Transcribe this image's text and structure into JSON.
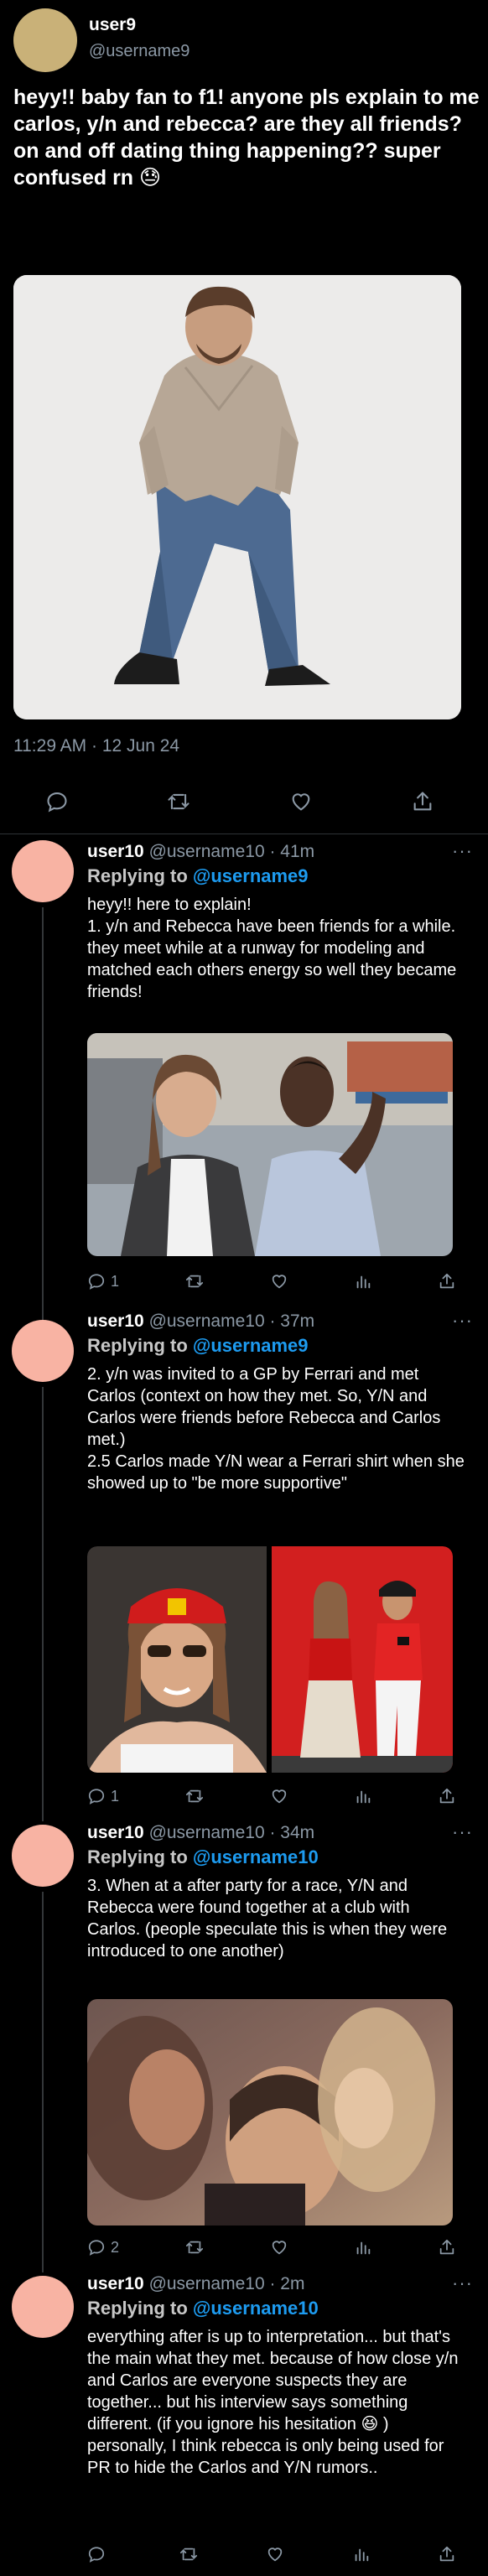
{
  "main_tweet": {
    "display_name": "user9",
    "handle": "@username9",
    "text": "heyy!! baby fan to f1! anyone pls explain to me carlos, y/n and rebecca? are they all friends? on and off dating thing happening?? super confused rn",
    "emoji": "😓",
    "timestamp": "11:29 AM · 12 Jun 24",
    "actions": [
      "reply-icon",
      "retweet-icon",
      "like-icon",
      "share-icon"
    ]
  },
  "replies": [
    {
      "display_name": "user10",
      "meta": "@username10 · 41m",
      "more": "···",
      "replying_prefix": "Replying to ",
      "replying_to": "@username9",
      "lines": [
        "heyy!! here to explain!",
        "1. y/n and Rebecca have been friends for a while. they meet while at a runway for modeling and matched each others energy so well they became friends!"
      ],
      "reply_count": "1"
    },
    {
      "display_name": "user10",
      "meta": "@username10 · 37m",
      "more": "···",
      "replying_prefix": "Replying to ",
      "replying_to": "@username9",
      "lines": [
        "2. y/n was invited to a GP by Ferrari and met Carlos (context on how they met. So, Y/N and Carlos were friends before Rebecca and Carlos met.)",
        "2.5 Carlos made Y/N wear a Ferrari shirt when she showed up to \"be more supportive\""
      ],
      "reply_count": "1"
    },
    {
      "display_name": "user10",
      "meta": "@username10 · 34m",
      "more": "···",
      "replying_prefix": "Replying to ",
      "replying_to": "@username10",
      "lines": [
        "3. When at a after party for a race, Y/N and Rebecca were found together at a club with Carlos. (people speculate this is when they were introduced to one another)"
      ],
      "reply_count": "2"
    },
    {
      "display_name": "user10",
      "meta": "@username10 · 2m",
      "more": "···",
      "replying_prefix": "Replying to ",
      "replying_to": "@username10",
      "lines": [
        "everything after is up to interpretation... but that's the main what they met. because of how close y/n and Carlos are everyone suspects they are together... but his interview says something different. (if you ignore his hesitation 😆 )",
        "personally, I think rebecca is only being used for PR to hide the Carlos and Y/N rumors.."
      ],
      "reply_count": ""
    }
  ],
  "colors": {
    "background": "#000000",
    "text": "#e7e9ea",
    "muted": "#8b98a5",
    "mention": "#1d9bf0",
    "divider": "#2f3336",
    "avatar_main": "#c9b178",
    "avatar_reply": "#f8b3a3"
  }
}
